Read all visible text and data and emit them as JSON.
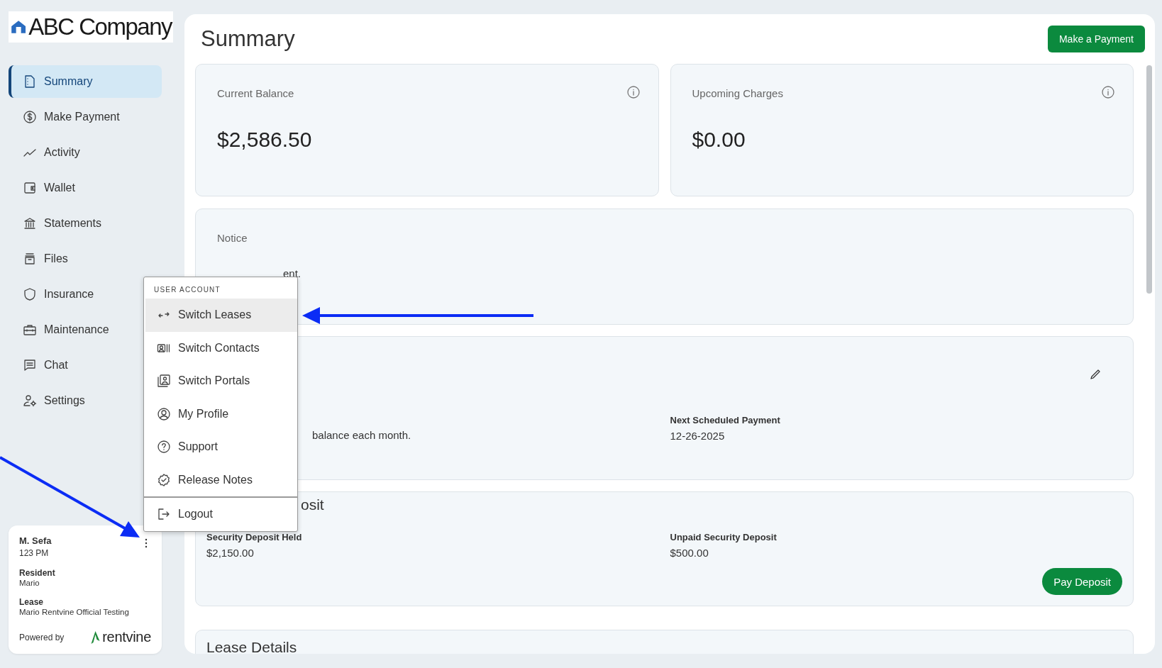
{
  "logo": {
    "text": "ABC Company"
  },
  "nav": [
    {
      "label": "Summary",
      "selected": true
    },
    {
      "label": "Make Payment",
      "selected": false
    },
    {
      "label": "Activity",
      "selected": false
    },
    {
      "label": "Wallet",
      "selected": false
    },
    {
      "label": "Statements",
      "selected": false
    },
    {
      "label": "Files",
      "selected": false
    },
    {
      "label": "Insurance",
      "selected": false
    },
    {
      "label": "Maintenance",
      "selected": false
    },
    {
      "label": "Chat",
      "selected": false
    },
    {
      "label": "Settings",
      "selected": false
    }
  ],
  "account_card": {
    "name": "M. Sefa",
    "unit": "123 PM",
    "fields": [
      {
        "label": "Resident",
        "value": "Mario"
      },
      {
        "label": "Lease",
        "value": "Mario Rentvine Official Testing"
      }
    ],
    "powered_by": "Powered by",
    "brand": "rentvine"
  },
  "page": {
    "title": "Summary",
    "action": "Make a Payment"
  },
  "balances": [
    {
      "label": "Current Balance",
      "amount": "$2,586.50"
    },
    {
      "label": "Upcoming Charges",
      "amount": "$0.00"
    }
  ],
  "notice": {
    "title": "Notice",
    "text": "ent."
  },
  "autopay": {
    "description": "balance each month.",
    "fields": [
      {
        "label": "Next Scheduled Payment",
        "value": "12-26-2025"
      }
    ]
  },
  "deposit": {
    "title": "osit",
    "fields": [
      {
        "label": "Security Deposit Held",
        "value": "$2,150.00"
      },
      {
        "label": "Unpaid Security Deposit",
        "value": "$500.00"
      }
    ],
    "action": "Pay Deposit"
  },
  "lease_details": {
    "title": "Lease Details"
  },
  "user_menu": {
    "header": "USER ACCOUNT",
    "items": [
      {
        "label": "Switch Leases",
        "selected": true
      },
      {
        "label": "Switch Contacts",
        "selected": false
      },
      {
        "label": "Switch Portals",
        "selected": false
      },
      {
        "label": "My Profile",
        "selected": false
      },
      {
        "label": "Support",
        "selected": false
      },
      {
        "label": "Release Notes",
        "selected": false
      }
    ],
    "footer_item": {
      "label": "Logout"
    }
  }
}
